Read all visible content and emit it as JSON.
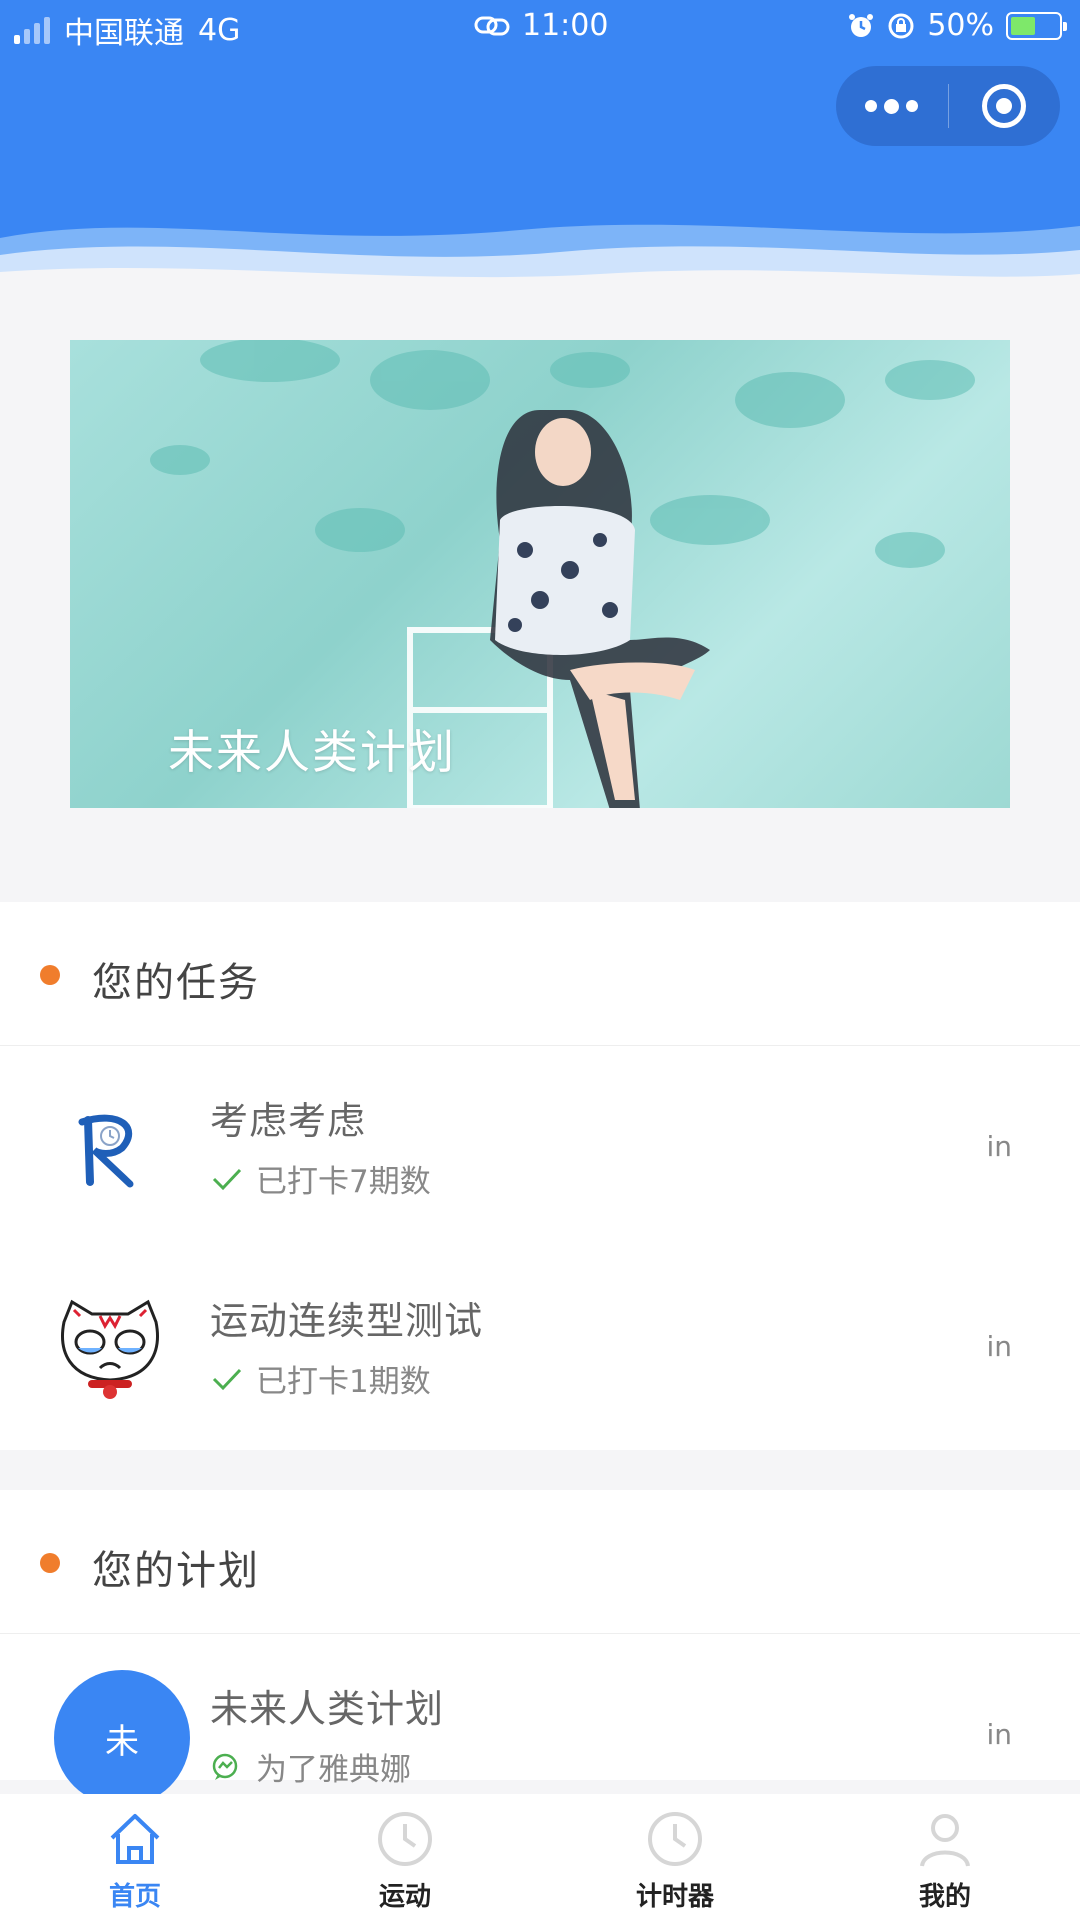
{
  "status_bar": {
    "carrier": "中国联通",
    "network": "4G",
    "time": "11:00",
    "battery": "50%"
  },
  "banner": {
    "caption": "未来人类计划"
  },
  "tasks_section": {
    "title": "您的任务",
    "items": [
      {
        "title": "考虑考虑",
        "status": "已打卡7期数",
        "more": "in"
      },
      {
        "title": "运动连续型测试",
        "status": "已打卡1期数",
        "more": "in"
      }
    ]
  },
  "plans_section": {
    "title": "您的计划",
    "items": [
      {
        "avatar_text": "未",
        "title": "未来人类计划",
        "subtitle": "为了雅典娜",
        "more": "in"
      }
    ]
  },
  "tabbar": {
    "items": [
      {
        "label": "首页",
        "icon": "home-icon",
        "active": true
      },
      {
        "label": "运动",
        "icon": "clock-icon",
        "active": false
      },
      {
        "label": "计时器",
        "icon": "clock-icon",
        "active": false
      },
      {
        "label": "我的",
        "icon": "user-icon",
        "active": false
      }
    ]
  },
  "colors": {
    "primary": "#3a86f3",
    "accent_dot": "#f07d2c",
    "check": "#4caf50"
  }
}
